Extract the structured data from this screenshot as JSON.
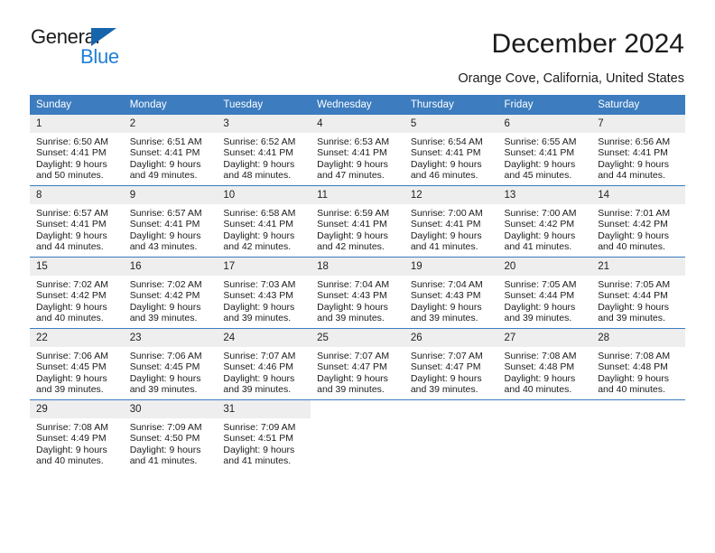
{
  "brand": {
    "name_top": "General",
    "name_bottom": "Blue",
    "accent_color": "#1f7fd4",
    "triangle_color": "#1665ab"
  },
  "header": {
    "title": "December 2024",
    "location": "Orange Cove, California, United States"
  },
  "calendar": {
    "header_bg": "#3c7cbf",
    "daynum_bg": "#eeeeee",
    "weekday_headers": [
      "Sunday",
      "Monday",
      "Tuesday",
      "Wednesday",
      "Thursday",
      "Friday",
      "Saturday"
    ],
    "weeks": [
      [
        {
          "day": "1",
          "sunrise": "Sunrise: 6:50 AM",
          "sunset": "Sunset: 4:41 PM",
          "daylight_line1": "Daylight: 9 hours",
          "daylight_line2": "and 50 minutes."
        },
        {
          "day": "2",
          "sunrise": "Sunrise: 6:51 AM",
          "sunset": "Sunset: 4:41 PM",
          "daylight_line1": "Daylight: 9 hours",
          "daylight_line2": "and 49 minutes."
        },
        {
          "day": "3",
          "sunrise": "Sunrise: 6:52 AM",
          "sunset": "Sunset: 4:41 PM",
          "daylight_line1": "Daylight: 9 hours",
          "daylight_line2": "and 48 minutes."
        },
        {
          "day": "4",
          "sunrise": "Sunrise: 6:53 AM",
          "sunset": "Sunset: 4:41 PM",
          "daylight_line1": "Daylight: 9 hours",
          "daylight_line2": "and 47 minutes."
        },
        {
          "day": "5",
          "sunrise": "Sunrise: 6:54 AM",
          "sunset": "Sunset: 4:41 PM",
          "daylight_line1": "Daylight: 9 hours",
          "daylight_line2": "and 46 minutes."
        },
        {
          "day": "6",
          "sunrise": "Sunrise: 6:55 AM",
          "sunset": "Sunset: 4:41 PM",
          "daylight_line1": "Daylight: 9 hours",
          "daylight_line2": "and 45 minutes."
        },
        {
          "day": "7",
          "sunrise": "Sunrise: 6:56 AM",
          "sunset": "Sunset: 4:41 PM",
          "daylight_line1": "Daylight: 9 hours",
          "daylight_line2": "and 44 minutes."
        }
      ],
      [
        {
          "day": "8",
          "sunrise": "Sunrise: 6:57 AM",
          "sunset": "Sunset: 4:41 PM",
          "daylight_line1": "Daylight: 9 hours",
          "daylight_line2": "and 44 minutes."
        },
        {
          "day": "9",
          "sunrise": "Sunrise: 6:57 AM",
          "sunset": "Sunset: 4:41 PM",
          "daylight_line1": "Daylight: 9 hours",
          "daylight_line2": "and 43 minutes."
        },
        {
          "day": "10",
          "sunrise": "Sunrise: 6:58 AM",
          "sunset": "Sunset: 4:41 PM",
          "daylight_line1": "Daylight: 9 hours",
          "daylight_line2": "and 42 minutes."
        },
        {
          "day": "11",
          "sunrise": "Sunrise: 6:59 AM",
          "sunset": "Sunset: 4:41 PM",
          "daylight_line1": "Daylight: 9 hours",
          "daylight_line2": "and 42 minutes."
        },
        {
          "day": "12",
          "sunrise": "Sunrise: 7:00 AM",
          "sunset": "Sunset: 4:41 PM",
          "daylight_line1": "Daylight: 9 hours",
          "daylight_line2": "and 41 minutes."
        },
        {
          "day": "13",
          "sunrise": "Sunrise: 7:00 AM",
          "sunset": "Sunset: 4:42 PM",
          "daylight_line1": "Daylight: 9 hours",
          "daylight_line2": "and 41 minutes."
        },
        {
          "day": "14",
          "sunrise": "Sunrise: 7:01 AM",
          "sunset": "Sunset: 4:42 PM",
          "daylight_line1": "Daylight: 9 hours",
          "daylight_line2": "and 40 minutes."
        }
      ],
      [
        {
          "day": "15",
          "sunrise": "Sunrise: 7:02 AM",
          "sunset": "Sunset: 4:42 PM",
          "daylight_line1": "Daylight: 9 hours",
          "daylight_line2": "and 40 minutes."
        },
        {
          "day": "16",
          "sunrise": "Sunrise: 7:02 AM",
          "sunset": "Sunset: 4:42 PM",
          "daylight_line1": "Daylight: 9 hours",
          "daylight_line2": "and 39 minutes."
        },
        {
          "day": "17",
          "sunrise": "Sunrise: 7:03 AM",
          "sunset": "Sunset: 4:43 PM",
          "daylight_line1": "Daylight: 9 hours",
          "daylight_line2": "and 39 minutes."
        },
        {
          "day": "18",
          "sunrise": "Sunrise: 7:04 AM",
          "sunset": "Sunset: 4:43 PM",
          "daylight_line1": "Daylight: 9 hours",
          "daylight_line2": "and 39 minutes."
        },
        {
          "day": "19",
          "sunrise": "Sunrise: 7:04 AM",
          "sunset": "Sunset: 4:43 PM",
          "daylight_line1": "Daylight: 9 hours",
          "daylight_line2": "and 39 minutes."
        },
        {
          "day": "20",
          "sunrise": "Sunrise: 7:05 AM",
          "sunset": "Sunset: 4:44 PM",
          "daylight_line1": "Daylight: 9 hours",
          "daylight_line2": "and 39 minutes."
        },
        {
          "day": "21",
          "sunrise": "Sunrise: 7:05 AM",
          "sunset": "Sunset: 4:44 PM",
          "daylight_line1": "Daylight: 9 hours",
          "daylight_line2": "and 39 minutes."
        }
      ],
      [
        {
          "day": "22",
          "sunrise": "Sunrise: 7:06 AM",
          "sunset": "Sunset: 4:45 PM",
          "daylight_line1": "Daylight: 9 hours",
          "daylight_line2": "and 39 minutes."
        },
        {
          "day": "23",
          "sunrise": "Sunrise: 7:06 AM",
          "sunset": "Sunset: 4:45 PM",
          "daylight_line1": "Daylight: 9 hours",
          "daylight_line2": "and 39 minutes."
        },
        {
          "day": "24",
          "sunrise": "Sunrise: 7:07 AM",
          "sunset": "Sunset: 4:46 PM",
          "daylight_line1": "Daylight: 9 hours",
          "daylight_line2": "and 39 minutes."
        },
        {
          "day": "25",
          "sunrise": "Sunrise: 7:07 AM",
          "sunset": "Sunset: 4:47 PM",
          "daylight_line1": "Daylight: 9 hours",
          "daylight_line2": "and 39 minutes."
        },
        {
          "day": "26",
          "sunrise": "Sunrise: 7:07 AM",
          "sunset": "Sunset: 4:47 PM",
          "daylight_line1": "Daylight: 9 hours",
          "daylight_line2": "and 39 minutes."
        },
        {
          "day": "27",
          "sunrise": "Sunrise: 7:08 AM",
          "sunset": "Sunset: 4:48 PM",
          "daylight_line1": "Daylight: 9 hours",
          "daylight_line2": "and 40 minutes."
        },
        {
          "day": "28",
          "sunrise": "Sunrise: 7:08 AM",
          "sunset": "Sunset: 4:48 PM",
          "daylight_line1": "Daylight: 9 hours",
          "daylight_line2": "and 40 minutes."
        }
      ],
      [
        {
          "day": "29",
          "sunrise": "Sunrise: 7:08 AM",
          "sunset": "Sunset: 4:49 PM",
          "daylight_line1": "Daylight: 9 hours",
          "daylight_line2": "and 40 minutes."
        },
        {
          "day": "30",
          "sunrise": "Sunrise: 7:09 AM",
          "sunset": "Sunset: 4:50 PM",
          "daylight_line1": "Daylight: 9 hours",
          "daylight_line2": "and 41 minutes."
        },
        {
          "day": "31",
          "sunrise": "Sunrise: 7:09 AM",
          "sunset": "Sunset: 4:51 PM",
          "daylight_line1": "Daylight: 9 hours",
          "daylight_line2": "and 41 minutes."
        },
        {
          "day": "",
          "sunrise": "",
          "sunset": "",
          "daylight_line1": "",
          "daylight_line2": ""
        },
        {
          "day": "",
          "sunrise": "",
          "sunset": "",
          "daylight_line1": "",
          "daylight_line2": ""
        },
        {
          "day": "",
          "sunrise": "",
          "sunset": "",
          "daylight_line1": "",
          "daylight_line2": ""
        },
        {
          "day": "",
          "sunrise": "",
          "sunset": "",
          "daylight_line1": "",
          "daylight_line2": ""
        }
      ]
    ]
  }
}
